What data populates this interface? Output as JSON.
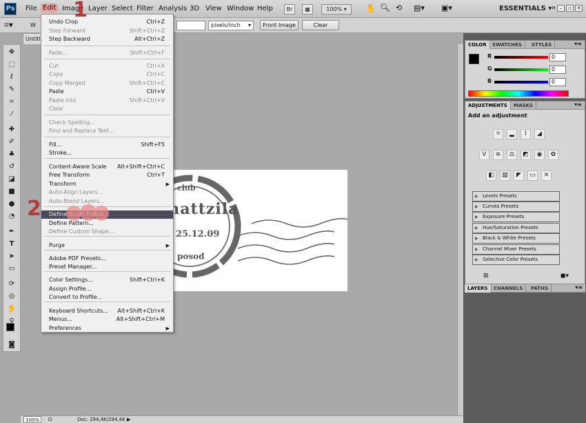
{
  "app": {
    "logo": "Ps"
  },
  "menubar": {
    "items": [
      "File",
      "Edit",
      "Image",
      "Layer",
      "Select",
      "Filter",
      "Analysis",
      "3D",
      "View",
      "Window",
      "Help"
    ],
    "bridge": "Br",
    "zoom": "100%",
    "workspace": "ESSENTIALS"
  },
  "options": {
    "units": "pixels/inch",
    "front_image": "Front Image",
    "clear": "Clear",
    "w_label": "W"
  },
  "doc": {
    "tab": "Untitled-1",
    "zoom": "100%",
    "info": "Doc: 294,4K/294,4K"
  },
  "stamp": {
    "text1": "club",
    "text2": "mattzila",
    "text3": "25.12.09",
    "text4": "posod"
  },
  "annotations": {
    "one": "1",
    "two": "2"
  },
  "edit_menu": {
    "items": [
      {
        "label": "Undo Crop",
        "shortcut": "Ctrl+Z",
        "disabled": false
      },
      {
        "label": "Step Forward",
        "shortcut": "Shift+Ctrl+Z",
        "disabled": true
      },
      {
        "label": "Step Backward",
        "shortcut": "Alt+Ctrl+Z",
        "disabled": false
      },
      {
        "label": "Fade...",
        "shortcut": "Shift+Ctrl+F",
        "disabled": true
      },
      {
        "label": "Cut",
        "shortcut": "Ctrl+X",
        "disabled": true
      },
      {
        "label": "Copy",
        "shortcut": "Ctrl+C",
        "disabled": true
      },
      {
        "label": "Copy Merged",
        "shortcut": "Shift+Ctrl+C",
        "disabled": true
      },
      {
        "label": "Paste",
        "shortcut": "Ctrl+V",
        "disabled": false
      },
      {
        "label": "Paste Into",
        "shortcut": "Shift+Ctrl+V",
        "disabled": true
      },
      {
        "label": "Clear",
        "shortcut": "",
        "disabled": true
      },
      {
        "label": "Check Spelling...",
        "shortcut": "",
        "disabled": true
      },
      {
        "label": "Find and Replace Text...",
        "shortcut": "",
        "disabled": true
      },
      {
        "label": "Fill...",
        "shortcut": "Shift+F5",
        "disabled": false
      },
      {
        "label": "Stroke...",
        "shortcut": "",
        "disabled": false
      },
      {
        "label": "Content-Aware Scale",
        "shortcut": "Alt+Shift+Ctrl+C",
        "disabled": false
      },
      {
        "label": "Free Transform",
        "shortcut": "Ctrl+T",
        "disabled": false
      },
      {
        "label": "Transform",
        "shortcut": "",
        "disabled": false
      },
      {
        "label": "Auto-Align Layers...",
        "shortcut": "",
        "disabled": true
      },
      {
        "label": "Auto-Blend Layers...",
        "shortcut": "",
        "disabled": true
      },
      {
        "label": "Define Brush Preset...",
        "shortcut": "",
        "disabled": false
      },
      {
        "label": "Define Pattern...",
        "shortcut": "",
        "disabled": false
      },
      {
        "label": "Define Custom Shape...",
        "shortcut": "",
        "disabled": true
      },
      {
        "label": "Purge",
        "shortcut": "",
        "disabled": false
      },
      {
        "label": "Adobe PDF Presets...",
        "shortcut": "",
        "disabled": false
      },
      {
        "label": "Preset Manager...",
        "shortcut": "",
        "disabled": false
      },
      {
        "label": "Color Settings...",
        "shortcut": "Shift+Ctrl+K",
        "disabled": false
      },
      {
        "label": "Assign Profile...",
        "shortcut": "",
        "disabled": false
      },
      {
        "label": "Convert to Profile...",
        "shortcut": "",
        "disabled": false
      },
      {
        "label": "Keyboard Shortcuts...",
        "shortcut": "Alt+Shift+Ctrl+K",
        "disabled": false
      },
      {
        "label": "Menus...",
        "shortcut": "Alt+Shift+Ctrl+M",
        "disabled": false
      },
      {
        "label": "Preferences",
        "shortcut": "",
        "disabled": false
      }
    ]
  },
  "color_panel": {
    "tabs": [
      "COLOR",
      "SWATCHES",
      "STYLES"
    ],
    "r_label": "R",
    "g_label": "G",
    "b_label": "B",
    "r": "0",
    "g": "0",
    "b": "0"
  },
  "adjustments_panel": {
    "tabs": [
      "ADJUSTMENTS",
      "MASKS"
    ],
    "heading": "Add an adjustment",
    "presets": [
      "Levels Presets",
      "Curves Presets",
      "Exposure Presets",
      "Hue/Saturation Presets",
      "Black & White Presets",
      "Channel Mixer Presets",
      "Selective Color Presets"
    ]
  },
  "layers_panel": {
    "tabs": [
      "LAYERS",
      "CHANNELS",
      "PATHS"
    ]
  }
}
